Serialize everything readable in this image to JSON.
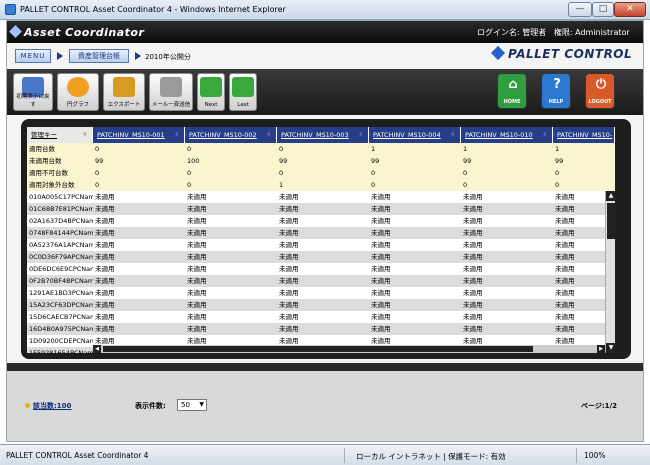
{
  "window": {
    "title": "PALLET CONTROL Asset Coordinator 4 - Windows Internet Explorer",
    "min": "—",
    "max": "□",
    "close": "✕"
  },
  "header": {
    "logo": "Asset Coordinator",
    "login_label": "ログイン名: 管理者",
    "authority_label": "権限: Administrator"
  },
  "breadcrumb": {
    "menu": "MENU",
    "asset": "資産管理台帳",
    "period": "2010年公開分",
    "brand": "PALLET CONTROL"
  },
  "toolbar": {
    "buttons": [
      {
        "label": "初期表示に戻す",
        "icon": "grid-reset-icon",
        "color": "#4a78c8"
      },
      {
        "label": "円グラフ",
        "icon": "pie-chart-icon",
        "color": "#f0a020"
      },
      {
        "label": "エクスポート",
        "icon": "export-icon",
        "color": "#d89a20"
      },
      {
        "label": "メール一斉送信",
        "icon": "mail-icon",
        "color": "#9a9a9a"
      },
      {
        "label": "Next",
        "icon": "next-arrow-icon",
        "color": "#3aa83a"
      },
      {
        "label": "Last",
        "icon": "last-arrow-icon",
        "color": "#3aa83a"
      }
    ],
    "right_buttons": [
      {
        "label": "HOME",
        "icon": "home-icon",
        "glyph": "⌂",
        "color": "#2e9e3e"
      },
      {
        "label": "HELP",
        "icon": "help-icon",
        "glyph": "?",
        "color": "#2a78d0"
      },
      {
        "label": "LOGOUT",
        "icon": "logout-icon",
        "glyph": "⏻",
        "color": "#d85a28"
      }
    ]
  },
  "grid": {
    "key_header": "管理キー",
    "columns": [
      "PATCHINV_MS10-001",
      "PATCHINV_MS10-002",
      "PATCHINV_MS10-003",
      "PATCHINV_MS10-004",
      "PATCHINV_MS10-010",
      "PATCHINV_MS10-"
    ],
    "summary_rows": [
      {
        "key": "適用台数",
        "values": [
          "0",
          "0",
          "0",
          "1",
          "1",
          "1"
        ]
      },
      {
        "key": "未適用台数",
        "values": [
          "99",
          "100",
          "99",
          "99",
          "99",
          "99"
        ]
      },
      {
        "key": "適用不可台数",
        "values": [
          "0",
          "0",
          "0",
          "0",
          "0",
          "0"
        ]
      },
      {
        "key": "適用対象外台数",
        "values": [
          "0",
          "0",
          "1",
          "0",
          "0",
          "0"
        ]
      }
    ],
    "data_rows": [
      {
        "key": "010A005C17PCName",
        "values": [
          "未適用",
          "未適用",
          "未適用",
          "未適用",
          "未適用",
          "未適用"
        ]
      },
      {
        "key": "01C68B7E81PCName",
        "values": [
          "未適用",
          "未適用",
          "未適用",
          "未適用",
          "未適用",
          "未適用"
        ]
      },
      {
        "key": "02A1637D4BPCName",
        "values": [
          "未適用",
          "未適用",
          "未適用",
          "未適用",
          "未適用",
          "未適用"
        ]
      },
      {
        "key": "0748F84144PCName",
        "values": [
          "未適用",
          "未適用",
          "未適用",
          "未適用",
          "未適用",
          "未適用"
        ]
      },
      {
        "key": "0A52376A1APCName",
        "values": [
          "未適用",
          "未適用",
          "未適用",
          "未適用",
          "未適用",
          "未適用"
        ]
      },
      {
        "key": "0C0D36F79APCName",
        "values": [
          "未適用",
          "未適用",
          "未適用",
          "未適用",
          "未適用",
          "未適用"
        ]
      },
      {
        "key": "0DE6DC6E9CPCName",
        "values": [
          "未適用",
          "未適用",
          "未適用",
          "未適用",
          "未適用",
          "未適用"
        ]
      },
      {
        "key": "0F2B70BF4BPCName",
        "values": [
          "未適用",
          "未適用",
          "未適用",
          "未適用",
          "未適用",
          "未適用"
        ]
      },
      {
        "key": "1291AE1BD3PCName",
        "values": [
          "未適用",
          "未適用",
          "未適用",
          "未適用",
          "未適用",
          "未適用"
        ]
      },
      {
        "key": "15A23CF63DPCName",
        "values": [
          "未適用",
          "未適用",
          "未適用",
          "未適用",
          "未適用",
          "未適用"
        ]
      },
      {
        "key": "15D6CAECB7PCName",
        "values": [
          "未適用",
          "未適用",
          "未適用",
          "未適用",
          "未適用",
          "未適用"
        ]
      },
      {
        "key": "16D4B0A975PCName",
        "values": [
          "未適用",
          "未適用",
          "未適用",
          "未適用",
          "未適用",
          "未適用"
        ]
      },
      {
        "key": "1D09200CDEPCName",
        "values": [
          "未適用",
          "未適用",
          "未適用",
          "未適用",
          "未適用",
          "未適用"
        ]
      },
      {
        "key": "1F59281654PCName",
        "values": [
          "未適用",
          "未適用",
          "未適用",
          "未適用",
          "未適用",
          "未適用"
        ]
      }
    ],
    "colors": {
      "summary_bg": "#fbf5cf",
      "row_alt": "#dcdcdc",
      "row": "#ffffff",
      "header": "#243f87"
    }
  },
  "footer": {
    "count": "該当数:100",
    "show_label": "表示件数:",
    "show_value": "50",
    "page": "ページ:1/2"
  },
  "statusbar": {
    "text": "PALLET CONTROL Asset Coordinator 4",
    "zone": "ローカル イントラネット | 保護モード: 有効",
    "zoom": "100%"
  }
}
